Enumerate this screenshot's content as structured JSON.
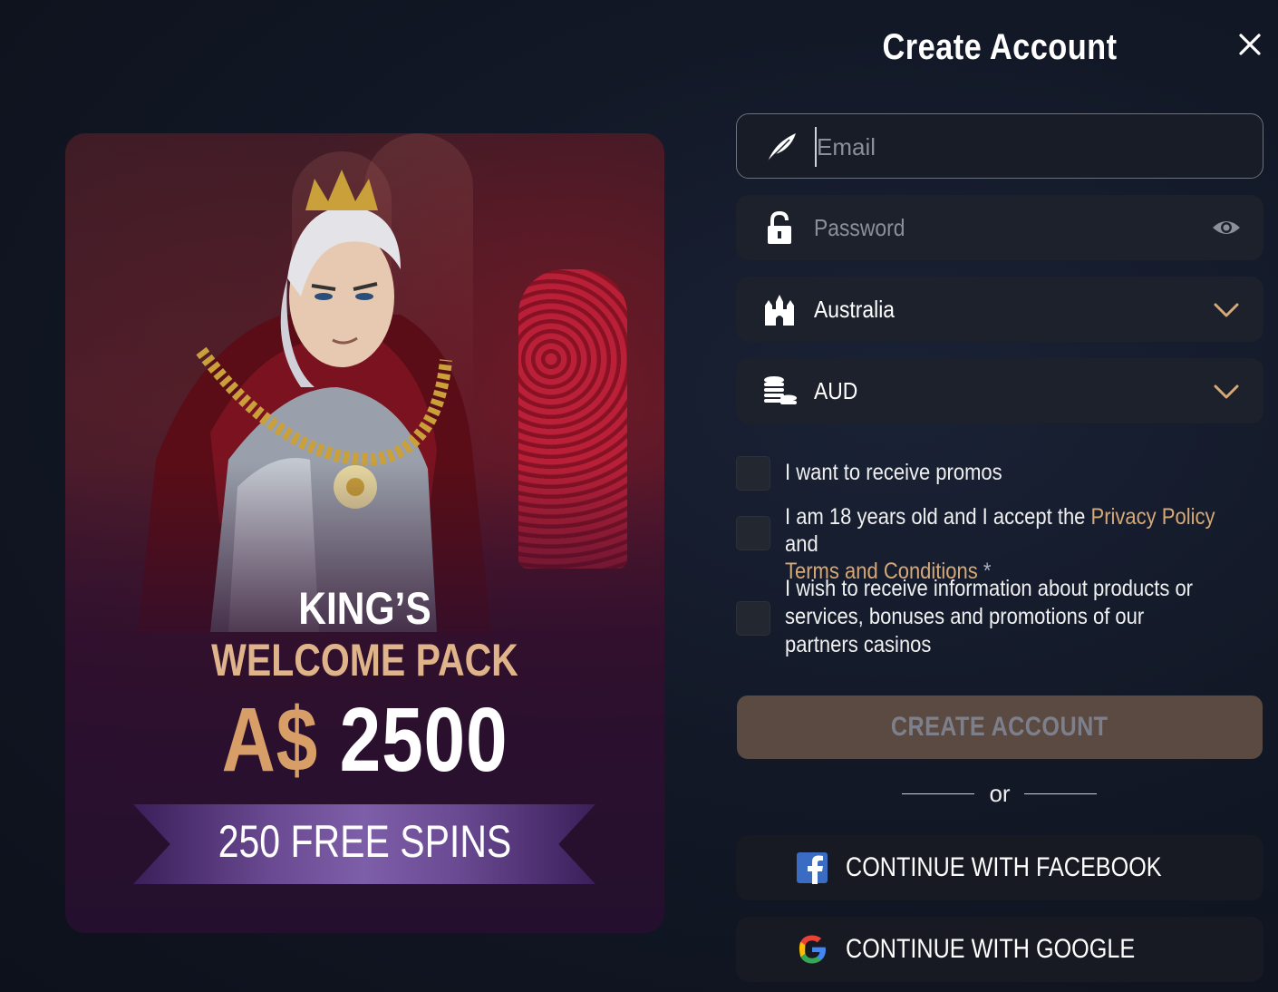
{
  "header": {
    "title": "Create Account"
  },
  "promo": {
    "line1": "KING’S",
    "line2": "WELCOME PACK",
    "currency": "A$",
    "amount": "2500",
    "spins": "250 FREE SPINS"
  },
  "form": {
    "email_placeholder": "Email",
    "password_placeholder": "Password",
    "country_value": "Australia",
    "currency_value": "AUD",
    "checkbox_promos": "I want to receive promos",
    "checkbox_terms_prefix": "I am 18 years old and I accept the",
    "privacy_link": "Privacy Policy",
    "and_word": "and",
    "terms_link": "Terms and Conditions",
    "required_mark": "*",
    "checkbox_partners": "I wish to receive information about products or services, bonuses and promotions of our partners casinos",
    "create_button": "CREATE ACCOUNT",
    "or_text": "or",
    "facebook_button": "CONTINUE WITH FACEBOOK",
    "google_button": "CONTINUE WITH GOOGLE"
  },
  "colors": {
    "accent_gold": "#d7a977",
    "create_button_bg": "#5a4a42",
    "field_bg": "#1d212c"
  }
}
